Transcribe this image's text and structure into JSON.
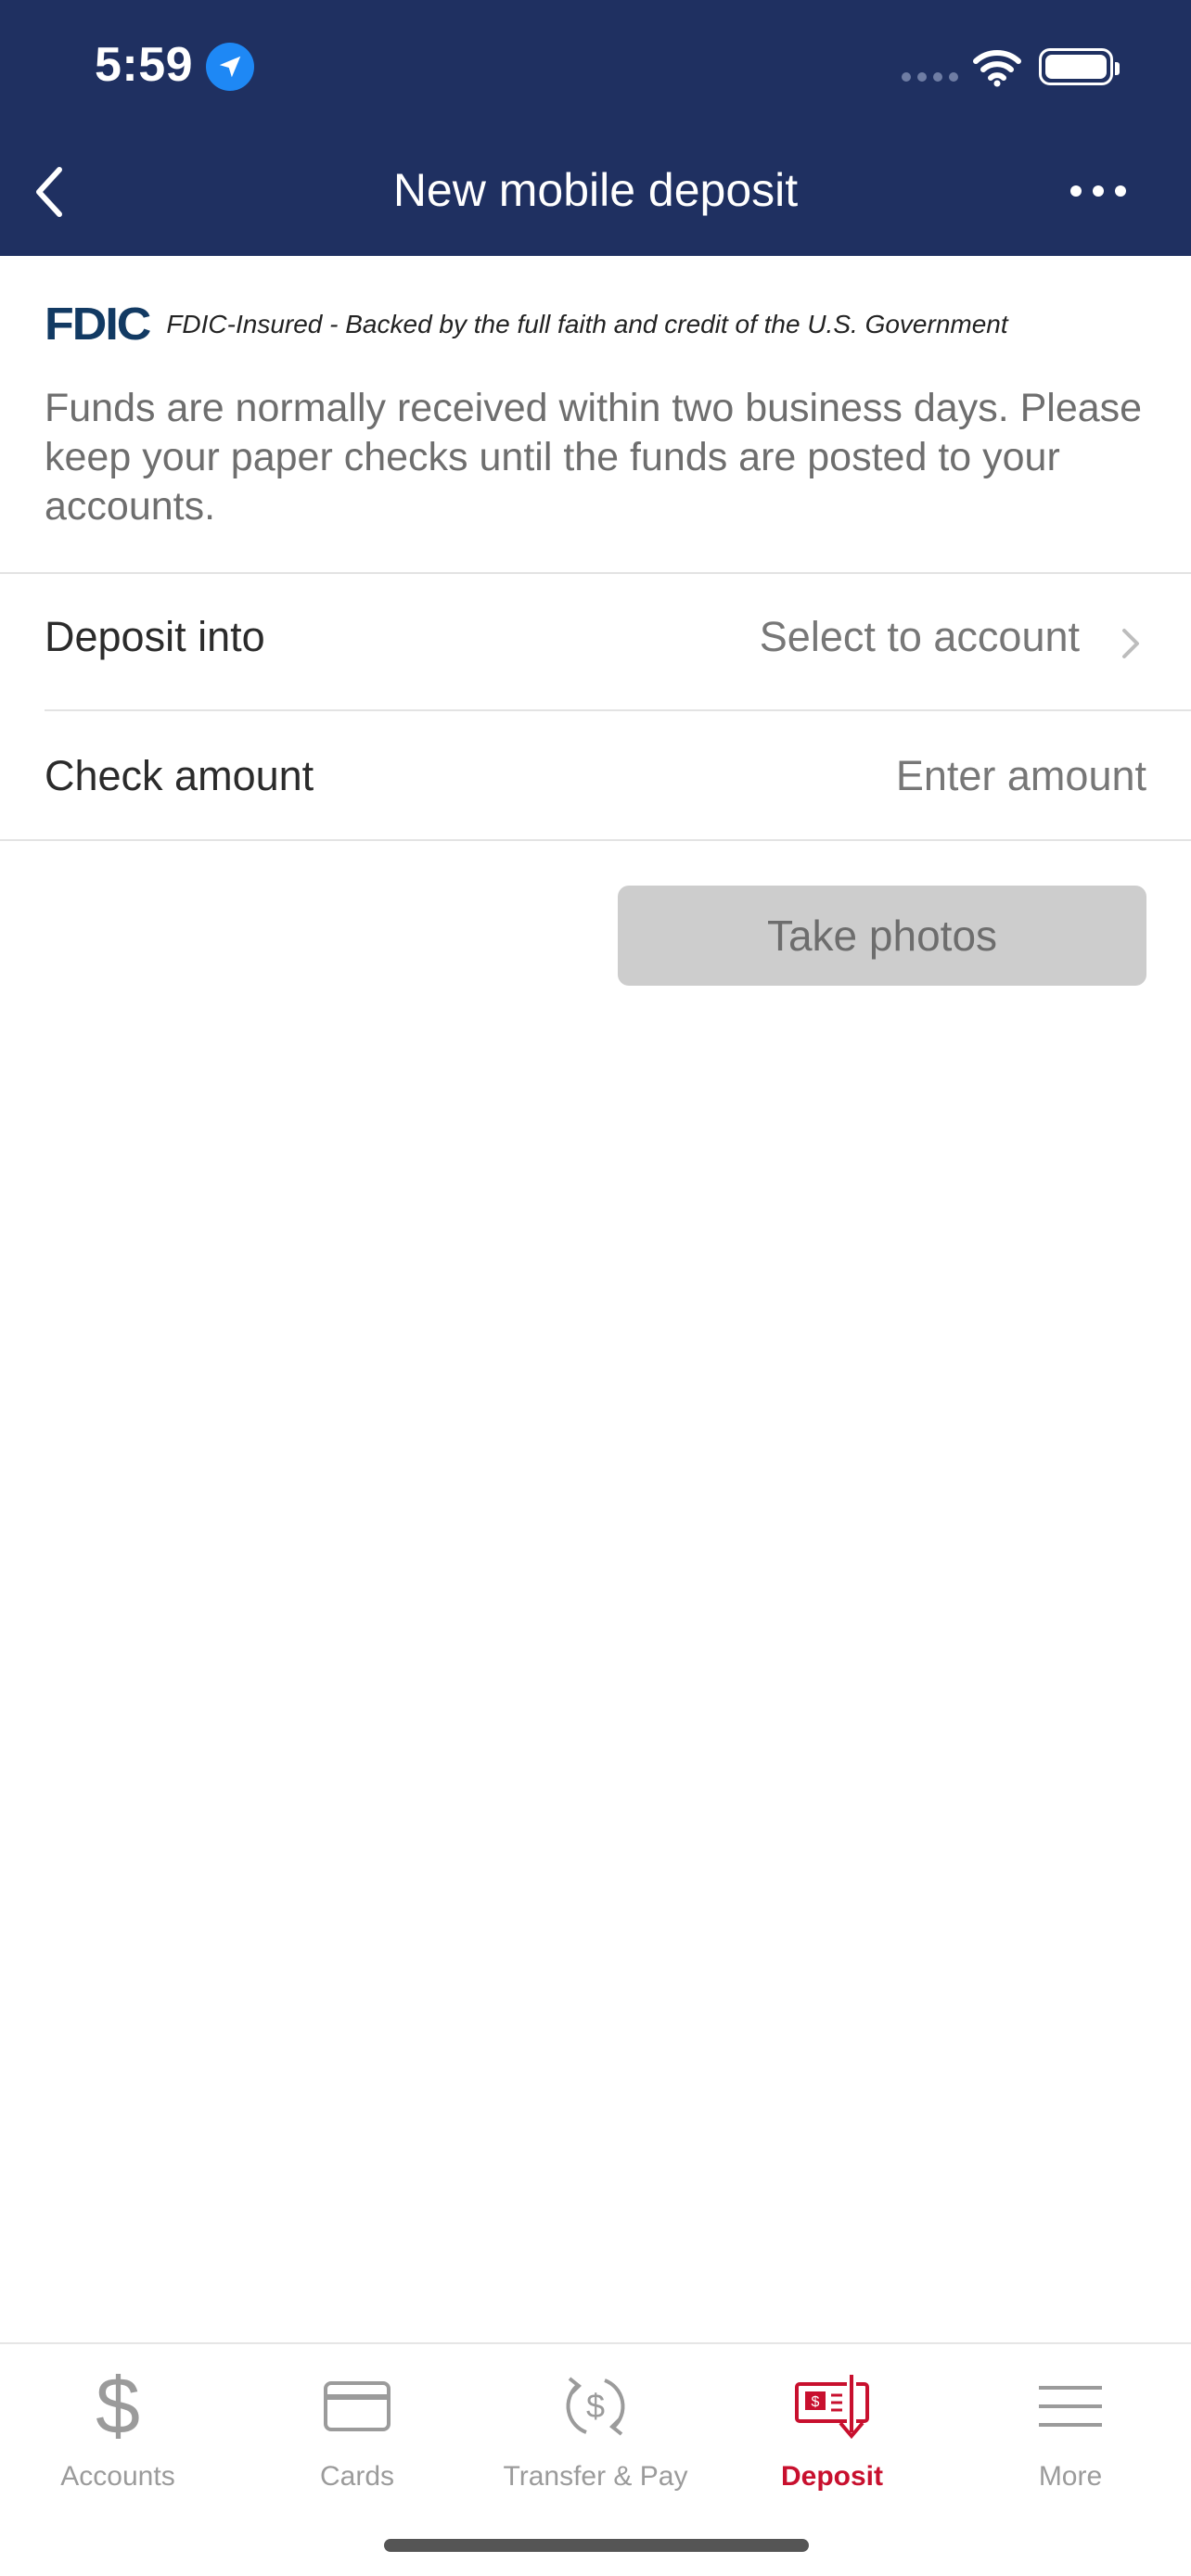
{
  "status_bar": {
    "time": "5:59"
  },
  "header": {
    "title": "New mobile deposit"
  },
  "fdic": {
    "logo": "FDIC",
    "text": "FDIC-Insured - Backed by the full faith and credit of the U.S. Government"
  },
  "info_text": "Funds are normally received within two business days. Please keep your paper checks until the funds are posted to your accounts.",
  "form": {
    "deposit_into": {
      "label": "Deposit into",
      "value": "Select to account"
    },
    "check_amount": {
      "label": "Check amount",
      "placeholder": "Enter amount"
    }
  },
  "take_photos_label": "Take photos",
  "tabs": [
    {
      "label": "Accounts",
      "icon": "dollar-icon",
      "active": false
    },
    {
      "label": "Cards",
      "icon": "card-icon",
      "active": false
    },
    {
      "label": "Transfer & Pay",
      "icon": "transfer-icon",
      "active": false
    },
    {
      "label": "Deposit",
      "icon": "check-deposit-icon",
      "active": true
    },
    {
      "label": "More",
      "icon": "menu-icon",
      "active": false
    }
  ],
  "colors": {
    "header_bg": "#1f3061",
    "accent": "#c8102e",
    "location": "#1e88f5"
  }
}
